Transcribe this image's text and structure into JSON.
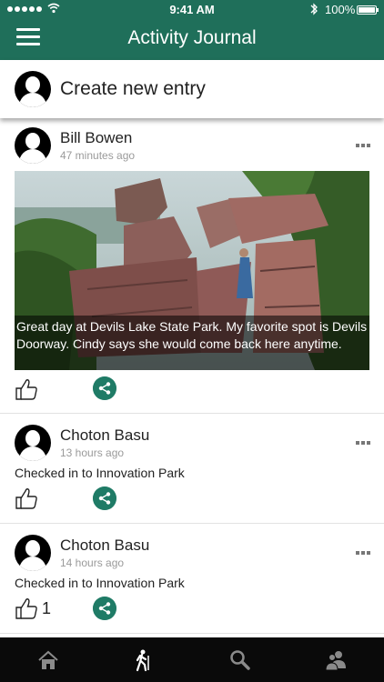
{
  "status": {
    "time": "9:41 AM",
    "battery": "100%"
  },
  "header": {
    "title": "Activity Journal"
  },
  "create": {
    "label": "Create new entry"
  },
  "posts": [
    {
      "author": "Bill Bowen",
      "time": "47 minutes ago",
      "caption": "Great day at Devils Lake State Park. My favorite spot is Devils Doorway. Cindy says she would come back here anytime."
    },
    {
      "author": "Choton Basu",
      "time": "13 hours ago",
      "text": "Checked in to Innovation Park"
    },
    {
      "author": "Choton Basu",
      "time": "14 hours ago",
      "text": "Checked in to Innovation Park",
      "likes": "1"
    }
  ],
  "tabs": [
    {
      "icon": "home-icon"
    },
    {
      "icon": "hiker-icon",
      "active": true
    },
    {
      "icon": "search-icon"
    },
    {
      "icon": "people-icon"
    }
  ],
  "colors": {
    "header": "#1f6f5a",
    "accent": "#1f7b66",
    "tabbar": "#0a0a0a"
  }
}
